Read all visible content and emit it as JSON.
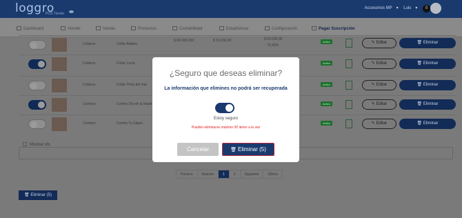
{
  "header": {
    "logo": "loggro",
    "logo_sub": "POS Tienda",
    "account": "Accesorios MP",
    "user": "Luis",
    "notifications": "0"
  },
  "nav": {
    "items": [
      "Dashboard",
      "Vender",
      "Ventas",
      "Productos",
      "Contabilidad",
      "Estadísticas",
      "Configuración",
      "Pagar Suscripción"
    ]
  },
  "table": {
    "rows": [
      {
        "category": "Collares",
        "name": "Collar Aldaba",
        "price": "$ 60.000,000",
        "price2": "$ 15.000,00",
        "price3": "$ 60.000,00",
        "percent": "76,92%",
        "status": "Activo",
        "edit": "Editar",
        "delete": "Eliminar"
      },
      {
        "category": "Collares",
        "name": "Collar Lucía",
        "status": "Activo",
        "edit": "Editar",
        "delete": "Eliminar"
      },
      {
        "category": "Collares",
        "name": "Collar Perla del mar",
        "status": "Activo",
        "edit": "Editar",
        "delete": "Eliminar"
      },
      {
        "category": "Combos",
        "name": "Combo Día de la Madre",
        "status": "Activo",
        "edit": "Editar",
        "delete": "Eliminar"
      },
      {
        "category": "Combos",
        "name": "Combo Tu Eliges",
        "status": "Activo",
        "edit": "Editar",
        "delete": "Eliminar"
      }
    ]
  },
  "filters": {
    "mostrar_ids": "Mostrar ids"
  },
  "pagination": {
    "items": [
      "Primero",
      "Anterior",
      "1",
      "2",
      "Siguiente",
      "Último"
    ]
  },
  "bulk_delete": "Eliminar (5)",
  "modal": {
    "title": "¿Seguro que deseas eliminar?",
    "subtitle": "La información que elimines no podrá ser recuperada",
    "check_label": "Estoy seguro",
    "warning": "Pueden eliminarse máximo 50 ítems a la vez",
    "cancel": "Cancelar",
    "confirm": "Eliminar (5)"
  },
  "colors": {
    "primary": "#1a3a6e",
    "danger_outline": "#c0263b",
    "warning_text": "#dd2222"
  }
}
